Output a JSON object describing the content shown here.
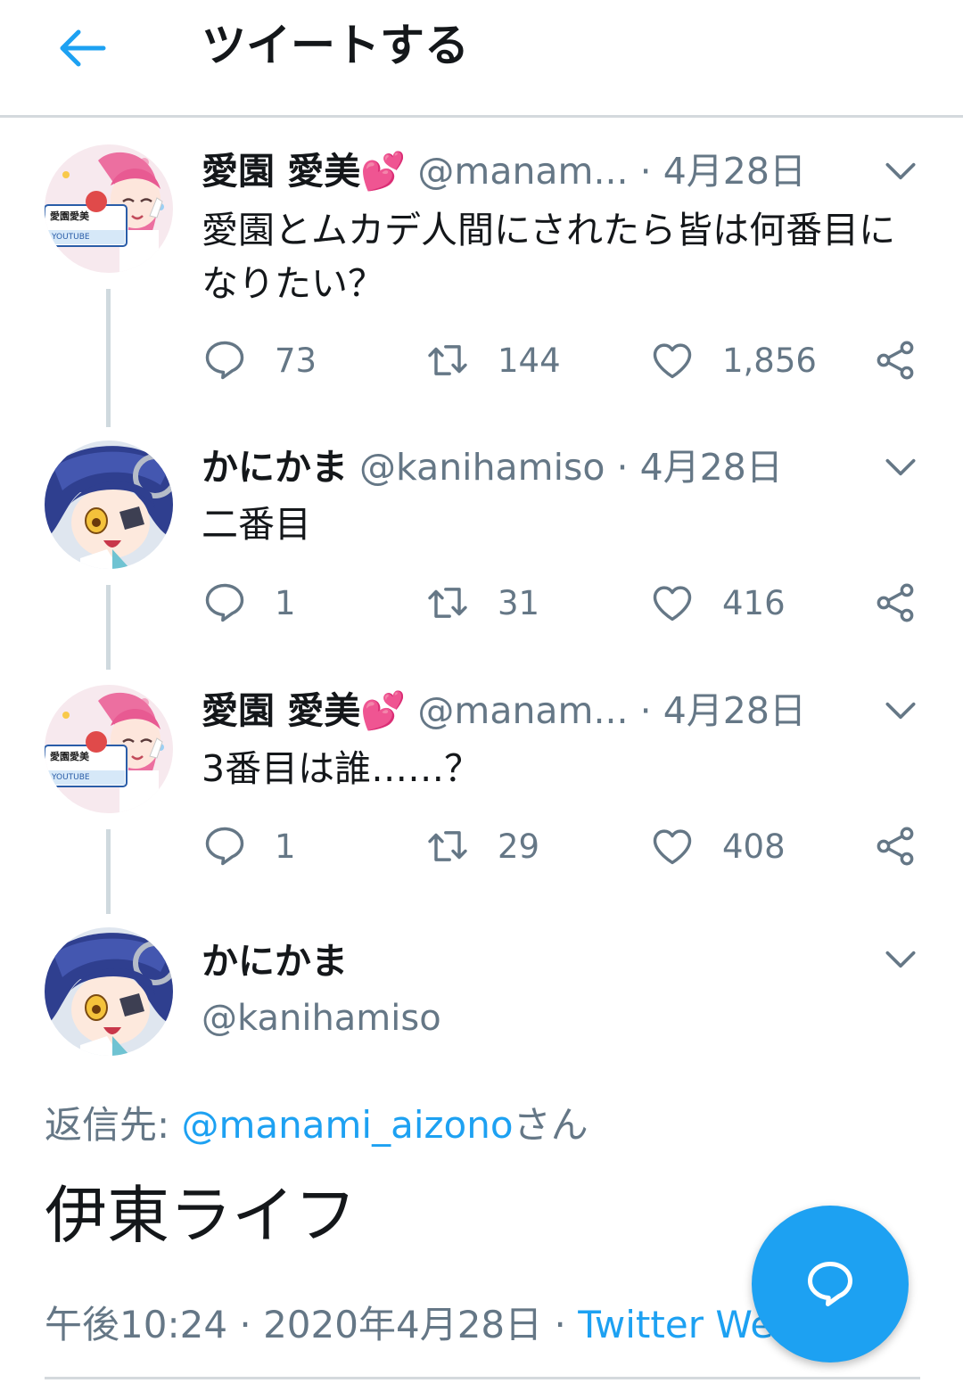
{
  "header": {
    "title": "ツイートする"
  },
  "thread": [
    {
      "name": "愛園 愛美💕",
      "handle": "@manam...",
      "date": "· 4月28日",
      "text": "愛園とムカデ人間にされたら皆は何番目になりたい？",
      "replies": "73",
      "retweets": "144",
      "likes": "1,856"
    },
    {
      "name": "かにかま",
      "handle": "@kanihamiso",
      "date": "· 4月28日",
      "text": "二番目",
      "replies": "1",
      "retweets": "31",
      "likes": "416"
    },
    {
      "name": "愛園 愛美💕",
      "handle": "@manam...",
      "date": "· 4月28日",
      "text": "3番目は誰……？",
      "replies": "1",
      "retweets": "29",
      "likes": "408"
    }
  ],
  "main_tweet": {
    "name": "かにかま",
    "handle": "@kanihamiso",
    "reply_prefix": "返信先: ",
    "reply_handle": "@manami_aizono",
    "reply_suffix": "さん",
    "text": "伊東ライフ",
    "time": "午後10:24 · 2020年4月28日 · ",
    "source": "Twitter Web"
  },
  "colors": {
    "accent": "#1da1f2",
    "secondary_text": "#657786",
    "divider": "#d4d9dd"
  },
  "icons": {
    "back": "arrow-left-icon",
    "caret": "chevron-down-icon",
    "reply": "speech-bubble-icon",
    "retweet": "retweet-icon",
    "like": "heart-icon",
    "share": "share-icon",
    "compose": "compose-reply-icon"
  }
}
